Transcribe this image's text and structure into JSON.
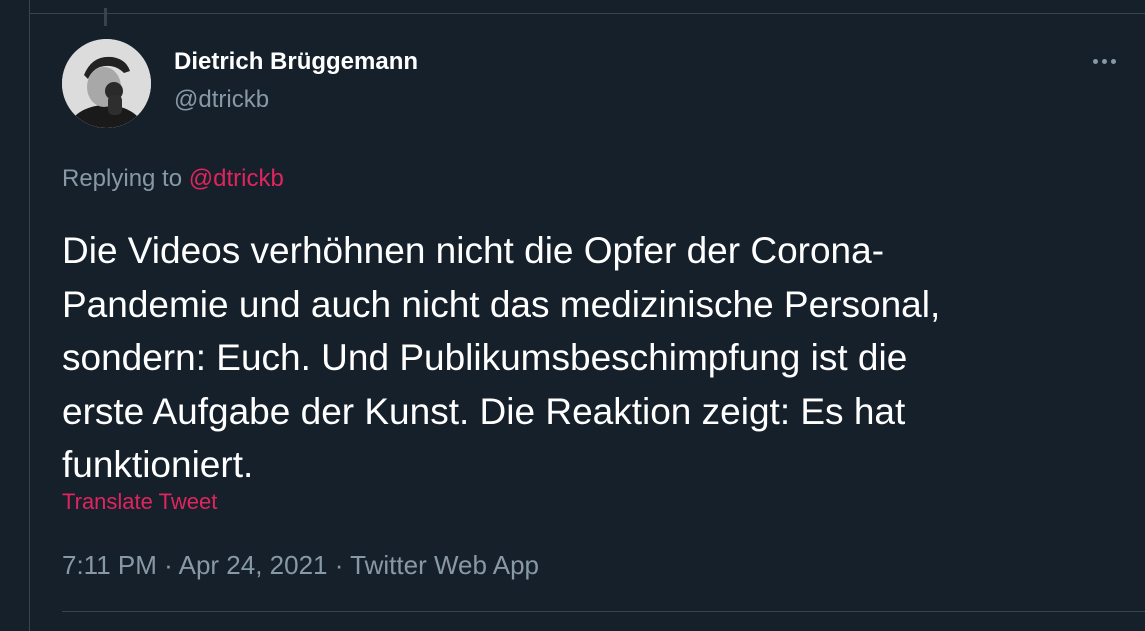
{
  "author": {
    "name": "Dietrich Brüggemann",
    "handle": "@dtrickb"
  },
  "reply": {
    "prefix": "Replying to",
    "mention": "@dtrickb"
  },
  "tweet": {
    "text": "Die Videos verhöhnen nicht die Opfer der Corona-Pandemie und auch nicht das medizinische Personal, sondern: Euch. Und Publikumsbeschimpfung ist die erste Aufgabe der Kunst. Die Reaktion zeigt: Es hat funktioniert.",
    "lines": [
      "Die Videos verhöhnen nicht die Opfer der Corona-",
      "Pandemie und auch nicht das medizinische Personal,",
      "sondern: Euch. Und Publikumsbeschimpfung ist die",
      "erste Aufgabe der Kunst. Die Reaktion zeigt: Es hat",
      "funktioniert."
    ],
    "translate_label": "Translate Tweet"
  },
  "meta": {
    "time": "7:11 PM",
    "separator": "·",
    "date": "Apr 24, 2021",
    "source": "Twitter Web App"
  },
  "icons": {
    "more": "more-horizontal-icon"
  },
  "colors": {
    "background": "#15202b",
    "text_primary": "#ffffff",
    "text_secondary": "#8899a6",
    "accent": "#e0245e",
    "border": "#38444d"
  }
}
